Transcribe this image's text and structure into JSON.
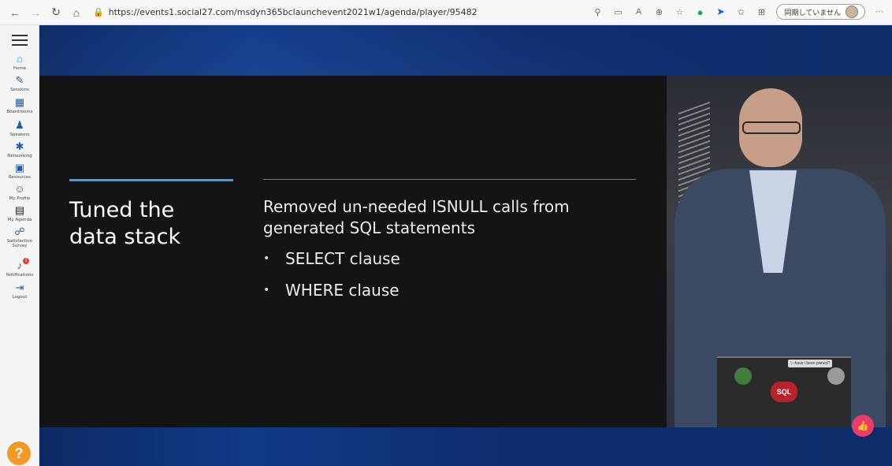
{
  "browser": {
    "back": "←",
    "forward": "→",
    "reload": "↻",
    "home": "⌂",
    "url": "https://events1.social27.com/msdyn365bclaunchevent2021w1/agenda/player/95482",
    "sync_label": "同期していません",
    "more": "···"
  },
  "sidebar": {
    "items": [
      {
        "label": "Home",
        "icon": "home-icon",
        "glyph": "⌂"
      },
      {
        "label": "Sessions",
        "icon": "pencil-icon",
        "glyph": "✎"
      },
      {
        "label": "Boardrooms",
        "icon": "boardroom-icon",
        "glyph": "▦"
      },
      {
        "label": "Speakers",
        "icon": "speaker-icon",
        "glyph": "♟"
      },
      {
        "label": "Networking",
        "icon": "network-icon",
        "glyph": "✱"
      },
      {
        "label": "Resources",
        "icon": "resources-icon",
        "glyph": "▣"
      },
      {
        "label": "My Profile",
        "icon": "profile-icon",
        "glyph": "☺"
      },
      {
        "label": "My Agenda",
        "icon": "agenda-icon",
        "glyph": "▤"
      },
      {
        "label": "Satisfaction Survey",
        "icon": "survey-icon",
        "glyph": "☍"
      },
      {
        "label": "Notifications",
        "icon": "bell-icon",
        "glyph": "♪",
        "badge": "1"
      },
      {
        "label": "Logout",
        "icon": "logout-icon",
        "glyph": "⇥"
      }
    ],
    "help": "?"
  },
  "slide": {
    "title": "Tuned the data stack",
    "lead": "Removed un-needed ISNULL calls from generated SQL statements",
    "bullets": [
      "SELECT clause",
      "WHERE clause"
    ],
    "bullet_glyph": "•",
    "accent_color": "#39a0e4"
  },
  "speaker_video": {
    "laptop_sticker": "SQL",
    "laptop_quote": "';--have i been pwned?"
  },
  "like_button": "👍"
}
